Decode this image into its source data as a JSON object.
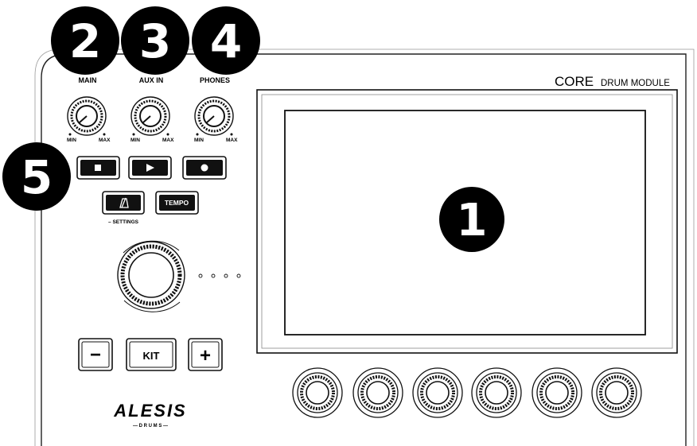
{
  "header": {
    "brand": "CORE",
    "subtitle": "DRUM MODULE"
  },
  "knobs": {
    "main": {
      "label": "MAIN",
      "min": "MIN",
      "max": "MAX"
    },
    "aux_in": {
      "label": "AUX IN",
      "min": "MIN",
      "max": "MAX"
    },
    "phones": {
      "label": "PHONES",
      "min": "MIN",
      "max": "MAX"
    }
  },
  "transport": {
    "stop_icon": "stop-icon",
    "play_icon": "play-icon",
    "record_icon": "record-icon"
  },
  "metronome": {
    "icon": "metronome-icon",
    "settings_label": "– SETTINGS"
  },
  "tempo": {
    "label": "TEMPO"
  },
  "kit": {
    "minus_label": "−",
    "kit_label": "KIT",
    "plus_label": "+"
  },
  "logo": {
    "name": "ALESIS",
    "sub": "— D R U M S —"
  },
  "callouts": {
    "screen": "1",
    "main": "2",
    "aux_in": "3",
    "phones": "4",
    "transport": "5"
  }
}
